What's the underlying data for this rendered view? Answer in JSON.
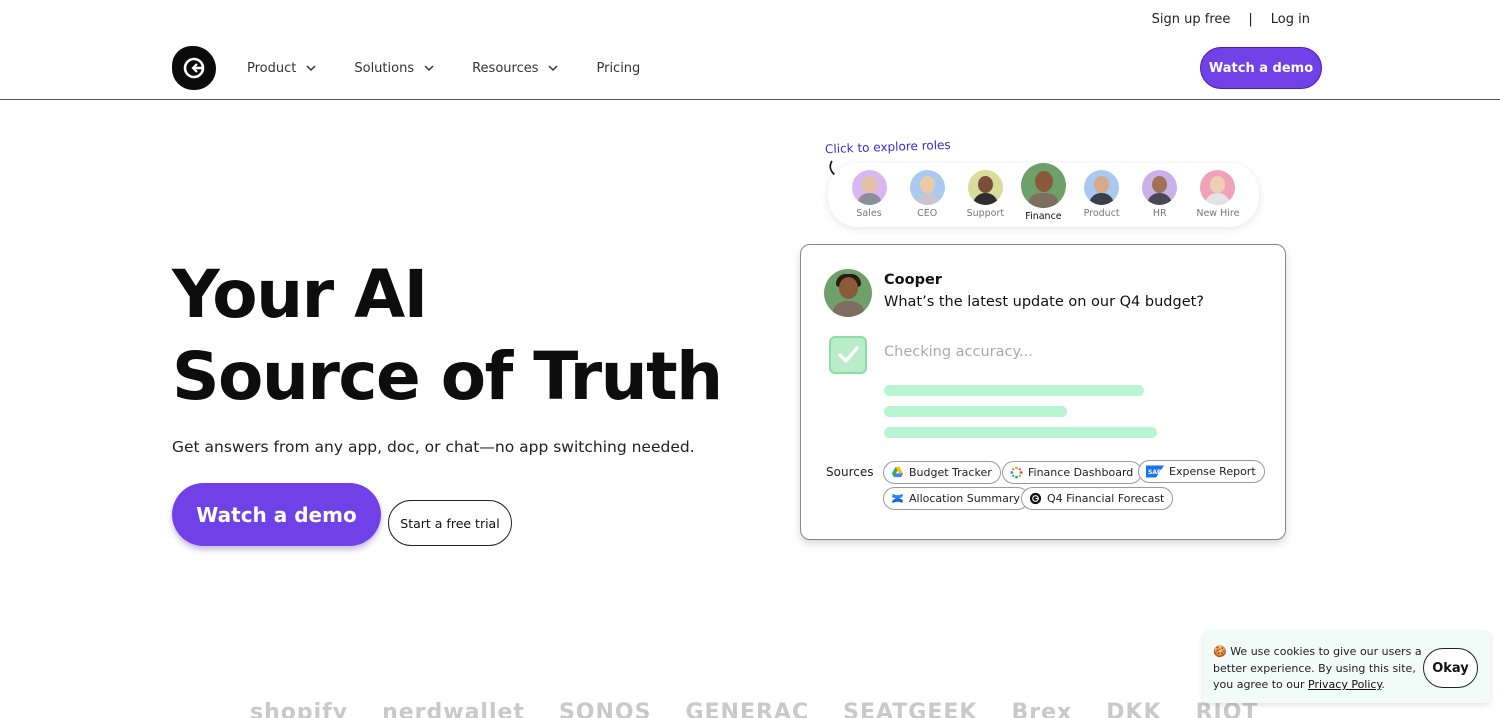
{
  "top_links": {
    "signup": "Sign up free",
    "separator": "|",
    "login": "Log in"
  },
  "nav": {
    "items": [
      {
        "label": "Product",
        "has_dropdown": true
      },
      {
        "label": "Solutions",
        "has_dropdown": true
      },
      {
        "label": "Resources",
        "has_dropdown": true
      },
      {
        "label": "Pricing",
        "has_dropdown": false
      }
    ],
    "cta": "Watch a demo"
  },
  "hero": {
    "title_line1": "Your AI",
    "title_line2": "Source of Truth",
    "subtitle": "Get answers from any app, doc, or chat—no app switching needed.",
    "primary_button": "Watch a demo",
    "secondary_button": "Start a free trial"
  },
  "roles": {
    "hint": "Click to explore roles",
    "items": [
      {
        "label": "Sales",
        "bg": "#d9b8f0",
        "skin": "#e7c0a4",
        "shirt": "#8a8f99",
        "active": false
      },
      {
        "label": "CEO",
        "bg": "#a9c9ef",
        "skin": "#eccaa6",
        "shirt": "#c9c4d0",
        "active": false
      },
      {
        "label": "Support",
        "bg": "#d9dc9a",
        "skin": "#7a5038",
        "shirt": "#2e2e2e",
        "active": false
      },
      {
        "label": "Finance",
        "bg": "#6ea06a",
        "skin": "#8a5a3b",
        "shirt": "#7e6e60",
        "active": true
      },
      {
        "label": "Product",
        "bg": "#a9c9ef",
        "skin": "#d9a88a",
        "shirt": "#3a3f4a",
        "active": false
      },
      {
        "label": "HR",
        "bg": "#c9b2ea",
        "skin": "#a27054",
        "shirt": "#474a56",
        "active": false
      },
      {
        "label": "New Hire",
        "bg": "#f0a3b8",
        "skin": "#efcfb4",
        "shirt": "#e3e2e8",
        "active": false
      }
    ]
  },
  "chat": {
    "name": "Cooper",
    "message": "What’s the latest update on our Q4 budget?",
    "status": "Checking accuracy...",
    "sources_label": "Sources",
    "sources": [
      {
        "label": "Budget Tracker",
        "icon": "google-drive-icon"
      },
      {
        "label": "Finance Dashboard",
        "icon": "dashboard-icon"
      },
      {
        "label": "Expense Report",
        "icon": "sap-icon"
      },
      {
        "label": "Allocation Summary",
        "icon": "confluence-icon"
      },
      {
        "label": "Q4 Financial Forecast",
        "icon": "guru-icon"
      }
    ]
  },
  "cookie": {
    "emoji": "🍪",
    "text": "We use cookies to give our users a better experience.  By using this site, you agree to our",
    "link": "Privacy Policy",
    "suffix": ".",
    "button": "Okay"
  },
  "logos": [
    "shopify",
    "nerdwallet",
    "SONOS",
    "GENERAC",
    "SEATGEEK",
    "Brex",
    "DKK",
    "RIOT"
  ],
  "colors": {
    "accent": "#7041e6",
    "text": "#111111",
    "bar": "#b8f5d2",
    "cookie_bg": "#f1fbf7"
  }
}
